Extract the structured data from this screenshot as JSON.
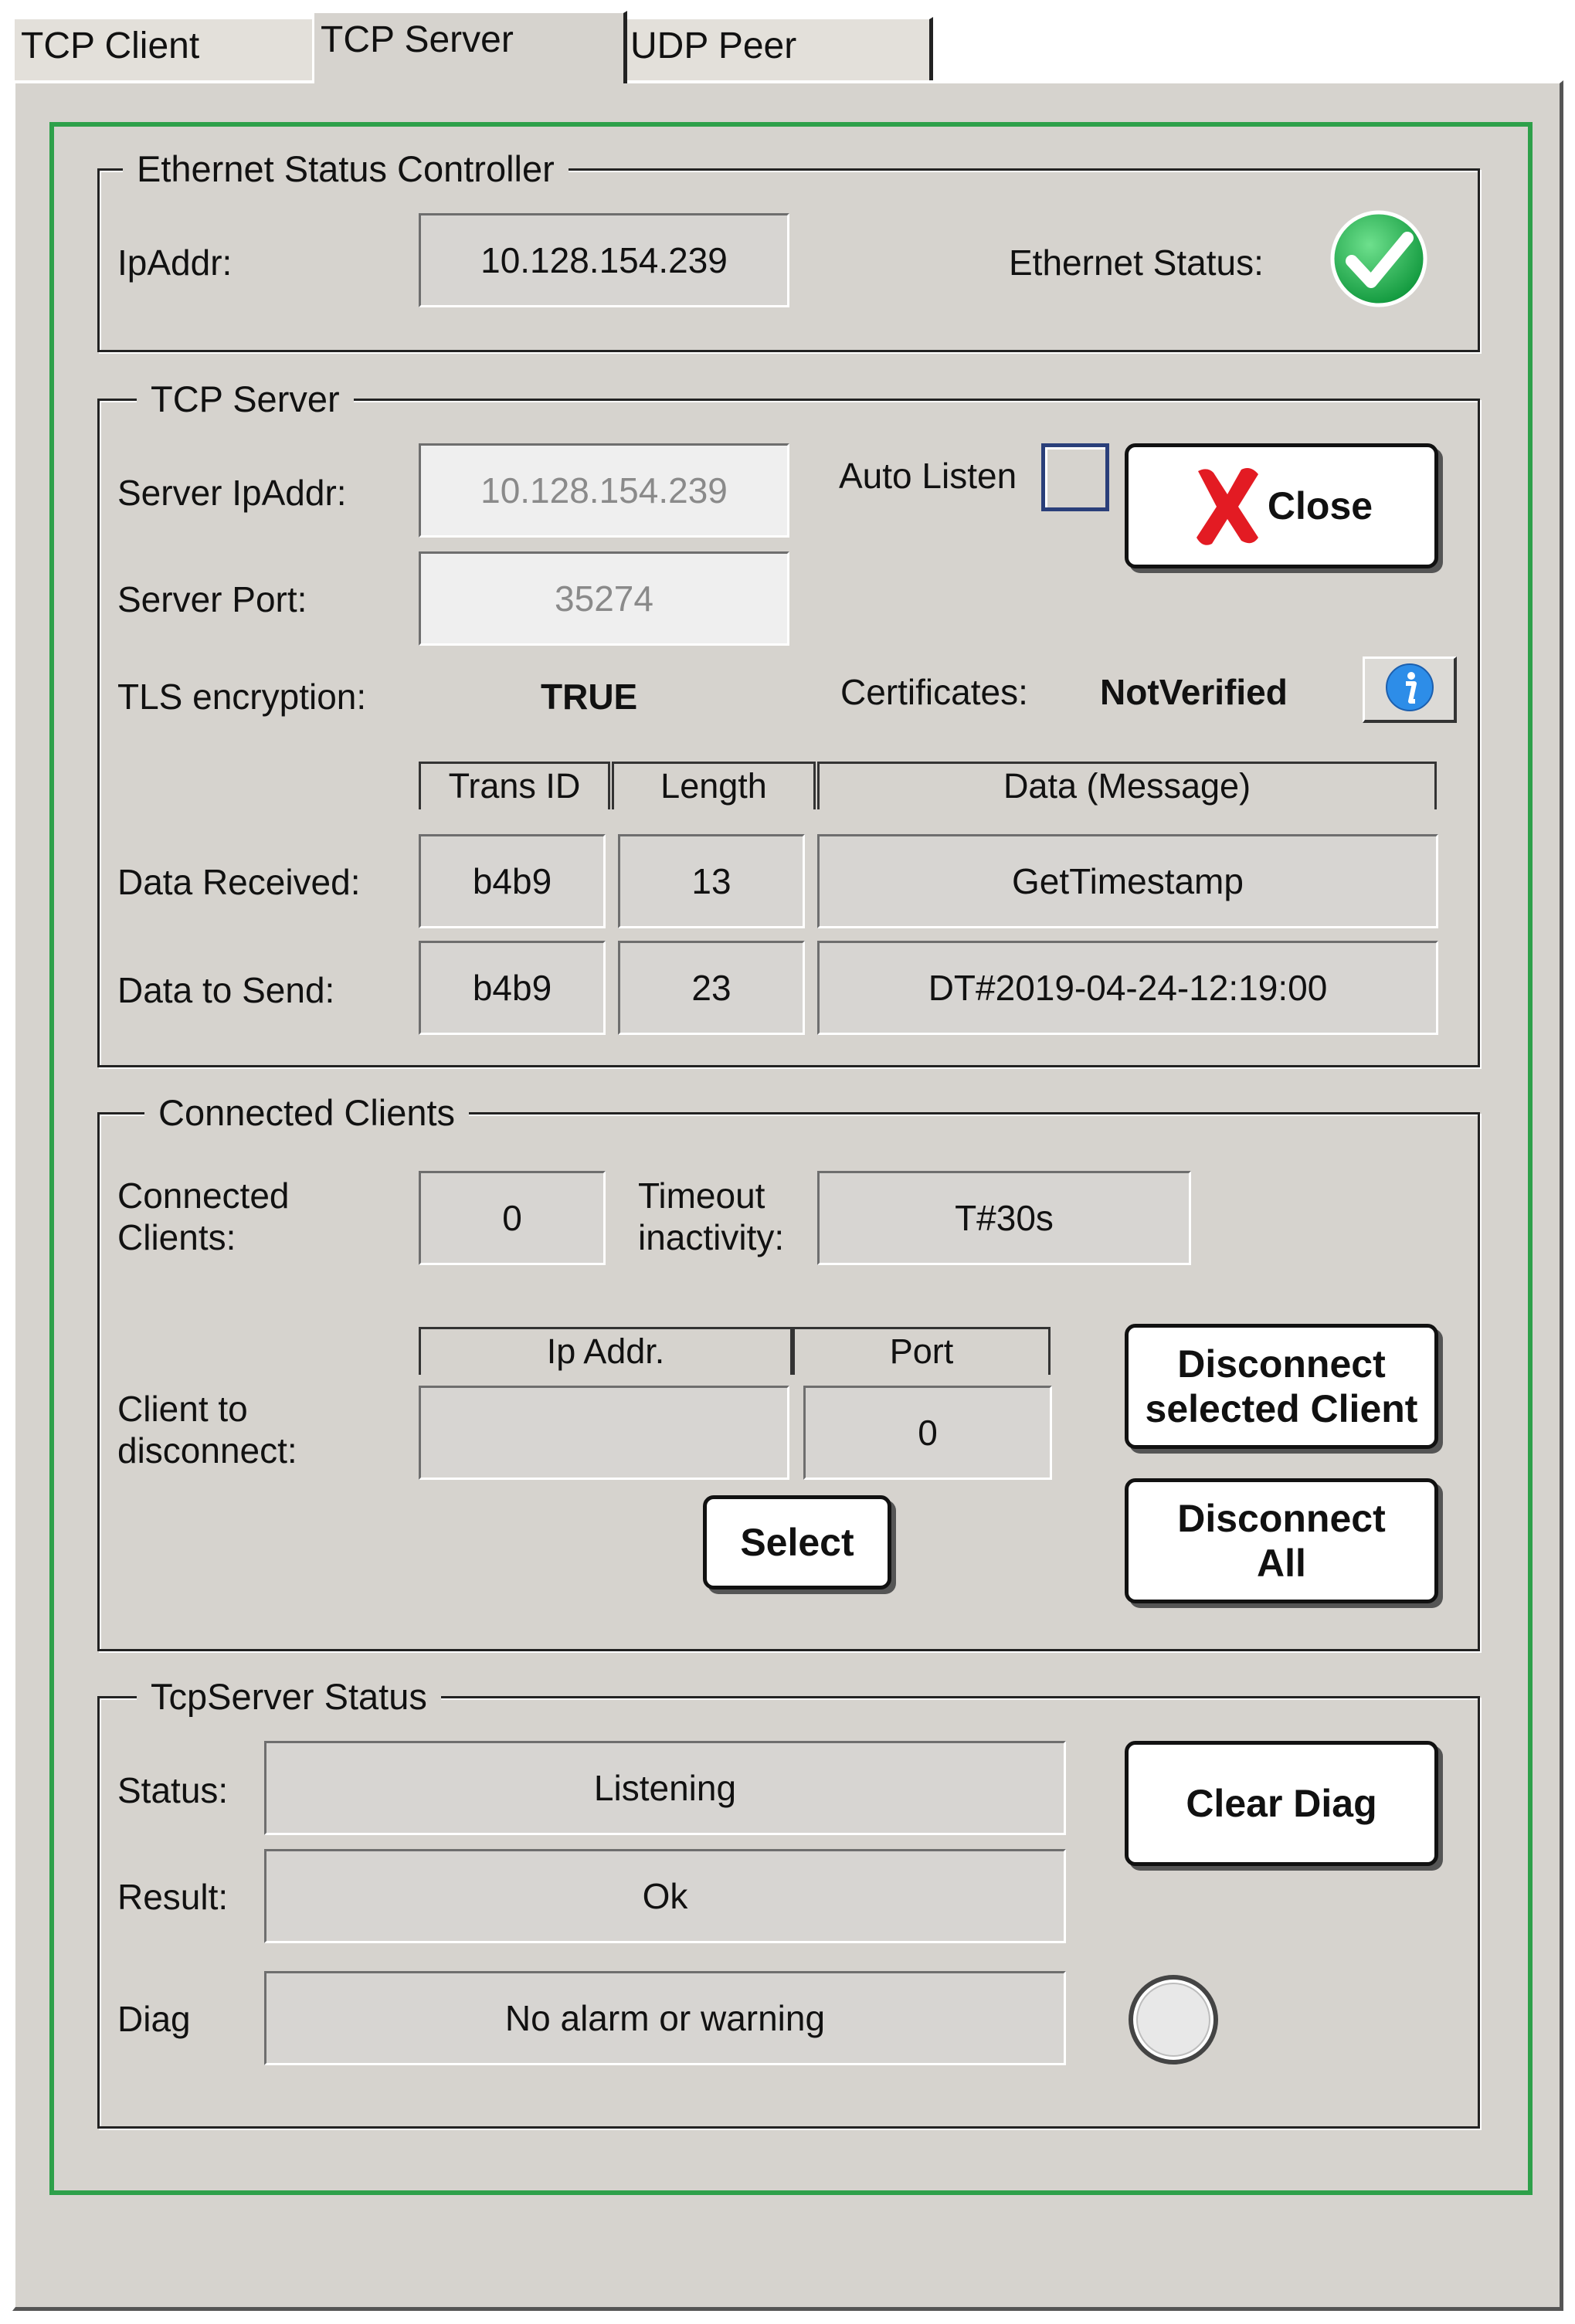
{
  "tabs": [
    {
      "label": "TCP Client"
    },
    {
      "label": "TCP Server"
    },
    {
      "label": "UDP Peer"
    }
  ],
  "ethernet_group": {
    "title": "Ethernet Status Controller",
    "ip_label": "IpAddr:",
    "ip_value": "10.128.154.239",
    "status_label": "Ethernet Status:",
    "status_icon": "check-ok-icon",
    "status_color": "#1fa84a"
  },
  "tcp_server_group": {
    "title": "TCP Server",
    "server_ip_label": "Server IpAddr:",
    "server_ip_value": "10.128.154.239",
    "server_port_label": "Server Port:",
    "server_port_value": "35274",
    "auto_listen_label": "Auto Listen",
    "auto_listen_checked": false,
    "close_label": "Close",
    "tls_label": "TLS encryption:",
    "tls_value": "TRUE",
    "cert_label": "Certificates:",
    "cert_value": "NotVerified",
    "info_icon": "info-icon",
    "columns": [
      "Trans ID",
      "Length",
      "Data (Message)"
    ],
    "rows": [
      {
        "label": "Data Received:",
        "trans_id": "b4b9",
        "length": "13",
        "data": "GetTimestamp"
      },
      {
        "label": "Data to Send:",
        "trans_id": "b4b9",
        "length": "23",
        "data": "DT#2019-04-24-12:19:00"
      }
    ]
  },
  "clients_group": {
    "title": "Connected Clients",
    "connected_label_1": "Connected",
    "connected_label_2": "Clients:",
    "connected_value": "0",
    "timeout_label_1": "Timeout",
    "timeout_label_2": "inactivity:",
    "timeout_value": "T#30s",
    "col_ip": "Ip Addr.",
    "col_port": "Port",
    "disc_label_1": "Client to",
    "disc_label_2": "disconnect:",
    "disc_ip_value": "",
    "disc_port_value": "0",
    "select_label": "Select",
    "disconnect_selected_1": "Disconnect",
    "disconnect_selected_2": "selected Client",
    "disconnect_all_1": "Disconnect",
    "disconnect_all_2": "All"
  },
  "status_group": {
    "title": "TcpServer Status",
    "status_label": "Status:",
    "status_value": "Listening",
    "result_label": "Result:",
    "result_value": "Ok",
    "diag_label": "Diag",
    "diag_value": "No alarm or warning",
    "clear_label": "Clear Diag",
    "diag_indicator_icon": "diag-led-icon",
    "diag_indicator_color": "#e8e8e8"
  }
}
